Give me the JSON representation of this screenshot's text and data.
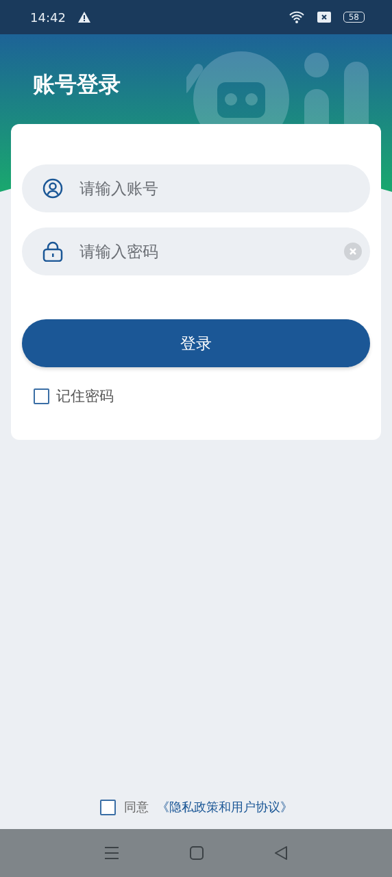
{
  "status_bar": {
    "time": "14:42",
    "battery": "58"
  },
  "header": {
    "title": "账号登录"
  },
  "form": {
    "account": {
      "placeholder": "请输入账号"
    },
    "password": {
      "placeholder": "请输入密码",
      "clearable": true
    },
    "login_button": "登录",
    "remember": {
      "label": "记住密码",
      "checked": false
    }
  },
  "agreement": {
    "checked": false,
    "prefix": "同意",
    "link": "《隐私政策和用户协议》"
  }
}
